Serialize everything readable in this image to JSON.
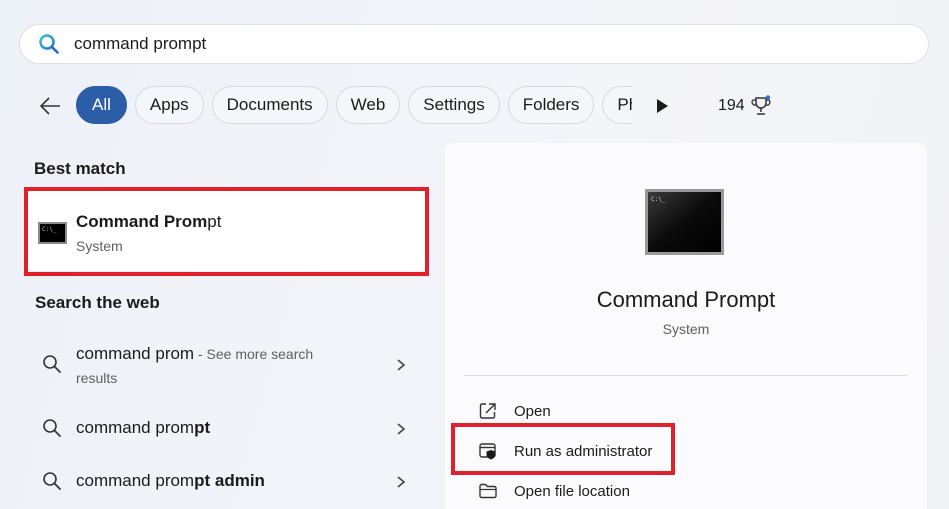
{
  "search": {
    "query": "command prompt",
    "icon": "search-icon",
    "accent": "#1aa7c8"
  },
  "filters": {
    "back_icon": "back-arrow-icon",
    "chips": [
      "All",
      "Apps",
      "Documents",
      "Web",
      "Settings",
      "Folders",
      "Pho"
    ],
    "active_index": 0,
    "active_color": "#2b5ea7",
    "more_icon": "play-icon",
    "points": "194",
    "points_icon": "trophy-icon"
  },
  "best_match": {
    "heading": "Best match",
    "title_bold": "Command Prom",
    "title_rest": "pt",
    "subtitle": "System",
    "icon": "command-prompt-icon"
  },
  "web": {
    "heading": "Search the web",
    "items": [
      {
        "query": "command prom",
        "bold": "",
        "more": " - See more search",
        "more2": "results"
      },
      {
        "query": "command prom",
        "bold": "pt",
        "more": "",
        "more2": ""
      },
      {
        "query": "command prom",
        "bold": "pt admin",
        "more": "",
        "more2": ""
      }
    ]
  },
  "detail": {
    "title": "Command Prompt",
    "subtitle": "System",
    "actions": [
      {
        "label": "Open",
        "icon": "open-external-icon"
      },
      {
        "label": "Run as administrator",
        "icon": "shield-window-icon"
      },
      {
        "label": "Open file location",
        "icon": "folder-icon"
      }
    ]
  },
  "highlight_color": "#e0202a"
}
